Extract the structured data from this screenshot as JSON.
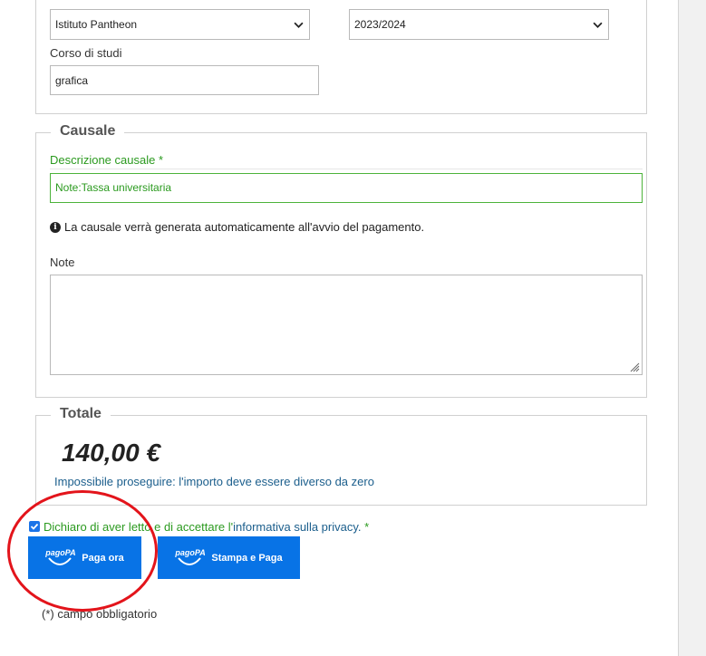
{
  "top_section": {
    "institute_select": {
      "value": "Istituto Pantheon"
    },
    "year_select": {
      "value": "2023/2024"
    },
    "course_label": "Corso di studi",
    "course_input": {
      "value": "grafica"
    }
  },
  "causale": {
    "legend": "Causale",
    "description_label": "Descrizione causale *",
    "description_value": "Note:Tassa universitaria",
    "info_text": "La causale verrà generata automaticamente all'avvio del pagamento.",
    "notes_label": "Note",
    "notes_value": ""
  },
  "totale": {
    "legend": "Totale",
    "amount": "140,00 €",
    "error": "Impossibile proseguire: l'importo deve essere diverso da zero"
  },
  "privacy": {
    "checked": true,
    "text_before": "Dichiaro di aver letto e di accettare l'",
    "link_text": "informativa sulla privacy.",
    "required_mark": " *"
  },
  "buttons": {
    "pay_now": "Paga ora",
    "print_and_pay": "Stampa e Paga",
    "logo_text": "pagoPA"
  },
  "footnote": "(*) campo obbligatorio",
  "colors": {
    "accent_blue": "#0873e6",
    "valid_green": "#2b9a1f",
    "link_blue": "#1b5e8c",
    "annotation_red": "#e3141b"
  }
}
